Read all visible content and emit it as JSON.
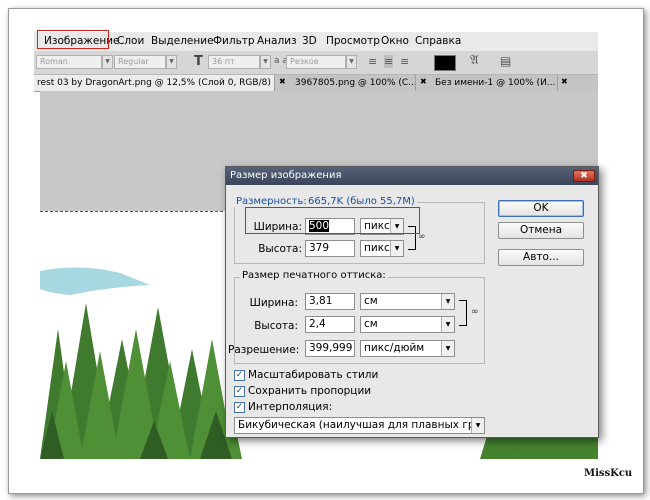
{
  "menubar": {
    "items": [
      "Изображение",
      "Слои",
      "Выделение",
      "Фильтр",
      "Анализ",
      "3D",
      "Просмотр",
      "Окно",
      "Справка"
    ]
  },
  "options_bar": {
    "font_family": "Roman",
    "font_style": "Regular",
    "font_size": "36 пт",
    "aa_label": "a a",
    "antialias": "Резкое"
  },
  "tabs": [
    "rest 03 by DragonArt.png @ 12,5% (Слой 0, RGB/8) *",
    "3967805.png @ 100% (С...",
    "Без имени-1 @ 100% (И..."
  ],
  "dialog": {
    "title": "Размер изображения",
    "size_label": "Размерность:",
    "size_value": "665,7K (было 55,7M)",
    "pixel": {
      "width_label": "Ширина:",
      "width_value": "500",
      "height_label": "Высота:",
      "height_value": "379",
      "unit": "пикс."
    },
    "print": {
      "group_label": "Размер печатного оттиска:",
      "width_label": "Ширина:",
      "width_value": "3,81",
      "height_label": "Высота:",
      "height_value": "2,4",
      "unit": "см",
      "resolution_label": "Разрешение:",
      "resolution_value": "399,999",
      "resolution_unit": "пикс/дюйм"
    },
    "options": [
      {
        "label": "Масштабировать стили",
        "checked": true
      },
      {
        "label": "Сохранить пропорции",
        "checked": true
      },
      {
        "label": "Интерполяция:",
        "checked": true
      }
    ],
    "interpolation": "Бикубическая (наилучшая для плавных градиентов)",
    "buttons": {
      "ok": "OK",
      "cancel": "Отмена",
      "auto": "Авто..."
    }
  },
  "watermark": "MissKcu",
  "colors": {
    "highlight": "#d0241f",
    "dialog_title": "#3b4559",
    "size_value": "#1a4fa0"
  }
}
